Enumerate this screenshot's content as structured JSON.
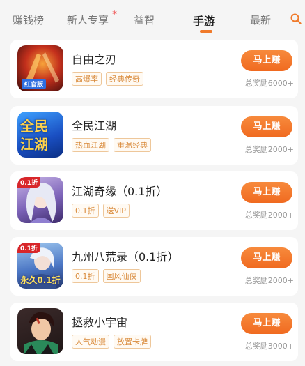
{
  "tabs": [
    {
      "label": "赚钱榜"
    },
    {
      "label": "新人专享"
    },
    {
      "label": "益智"
    },
    {
      "label": "手游"
    },
    {
      "label": "最新"
    }
  ],
  "active_tab_index": 3,
  "colors": {
    "accent": "#f07a2a",
    "tag_text": "#d98a3a",
    "tag_border": "#eec79a"
  },
  "games": [
    {
      "title": "自由之刃",
      "tags": [
        "高爆率",
        "经典传奇"
      ],
      "button": "马上赚",
      "reward": "总奖励6000+",
      "badge": "红官版"
    },
    {
      "title": "全民江湖",
      "tags": [
        "热血江湖",
        "重温经典"
      ],
      "button": "马上赚",
      "reward": "总奖励2000+",
      "icon_text": "全民江湖"
    },
    {
      "title": "江湖奇缘（0.1折）",
      "tags": [
        "0.1折",
        "送VIP"
      ],
      "button": "马上赚",
      "reward": "总奖励2000+",
      "corner": "0.1折"
    },
    {
      "title": "九州八荒录（0.1折）",
      "tags": [
        "0.1折",
        "国风仙侠"
      ],
      "button": "马上赚",
      "reward": "总奖励2000+",
      "corner": "0.1折",
      "icon_text": "永久0.1折"
    },
    {
      "title": "拯救小宇宙",
      "tags": [
        "人气动漫",
        "放置卡牌"
      ],
      "button": "马上赚",
      "reward": "总奖励3000+"
    }
  ]
}
